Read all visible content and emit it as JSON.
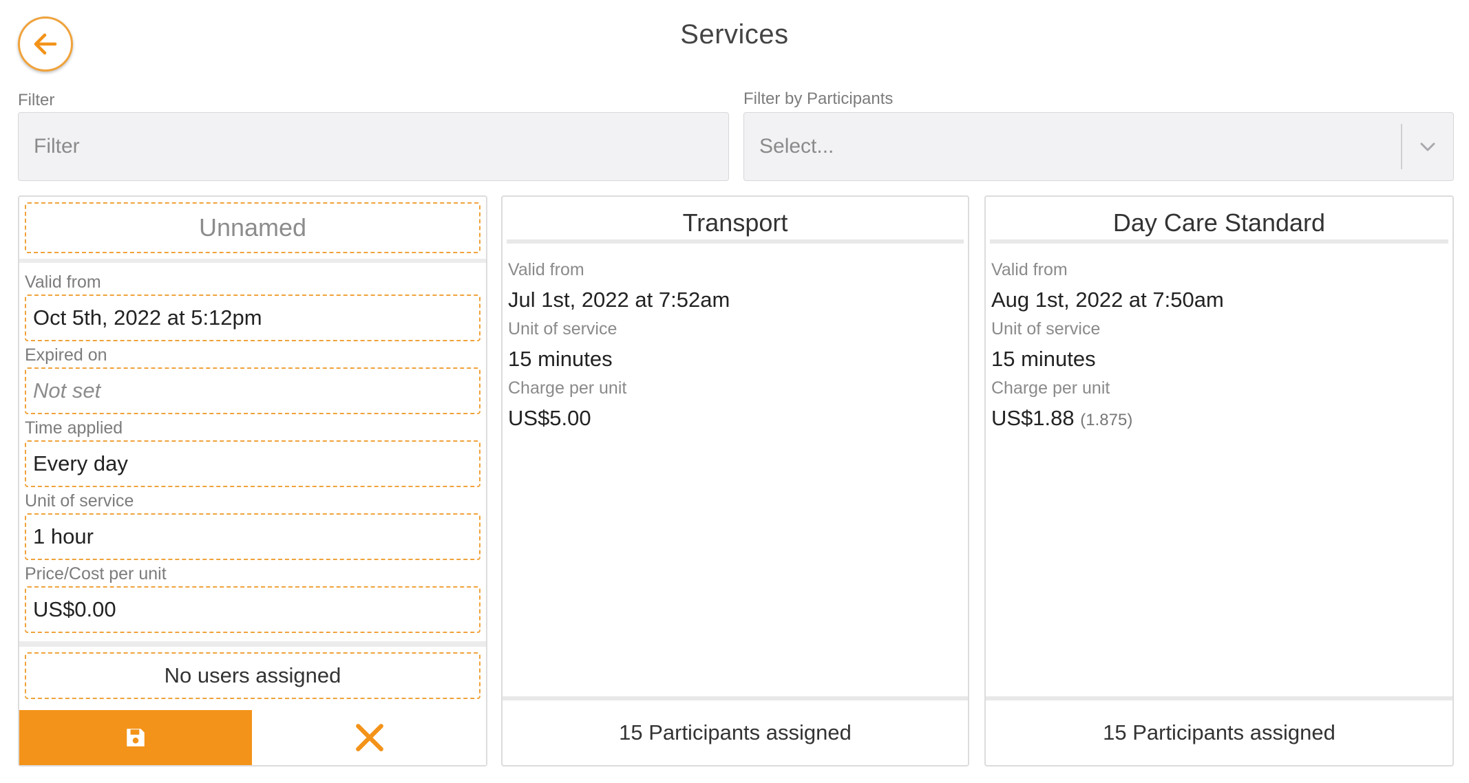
{
  "header": {
    "title": "Services",
    "back_icon": "arrow-left-icon"
  },
  "filters": {
    "filter_label": "Filter",
    "filter_placeholder": "Filter",
    "participants_label": "Filter by Participants",
    "participants_placeholder": "Select..."
  },
  "colors": {
    "accent": "#f39319",
    "accent_border": "#f0a23a"
  },
  "edit_card": {
    "title_placeholder": "Unnamed",
    "valid_from_label": "Valid from",
    "valid_from_value": "Oct 5th, 2022 at 5:12pm",
    "expired_on_label": "Expired on",
    "expired_on_value": "Not set",
    "time_applied_label": "Time applied",
    "time_applied_value": "Every day",
    "unit_label": "Unit of service",
    "unit_value": "1 hour",
    "price_label": "Price/Cost per unit",
    "price_value": "US$0.00",
    "users_text": "No users assigned",
    "save_icon": "save-icon",
    "cancel_icon": "close-icon"
  },
  "services": [
    {
      "title": "Transport",
      "valid_from_label": "Valid from",
      "valid_from": "Jul 1st, 2022 at 7:52am",
      "unit_label": "Unit of service",
      "unit": "15 minutes",
      "charge_label": "Charge per unit",
      "charge": "US$5.00",
      "charge_exact": "",
      "participants": "15 Participants assigned"
    },
    {
      "title": "Day Care Standard",
      "valid_from_label": "Valid from",
      "valid_from": "Aug 1st, 2022 at 7:50am",
      "unit_label": "Unit of service",
      "unit": "15 minutes",
      "charge_label": "Charge per unit",
      "charge": "US$1.88",
      "charge_exact": "(1.875)",
      "participants": "15 Participants assigned"
    }
  ]
}
